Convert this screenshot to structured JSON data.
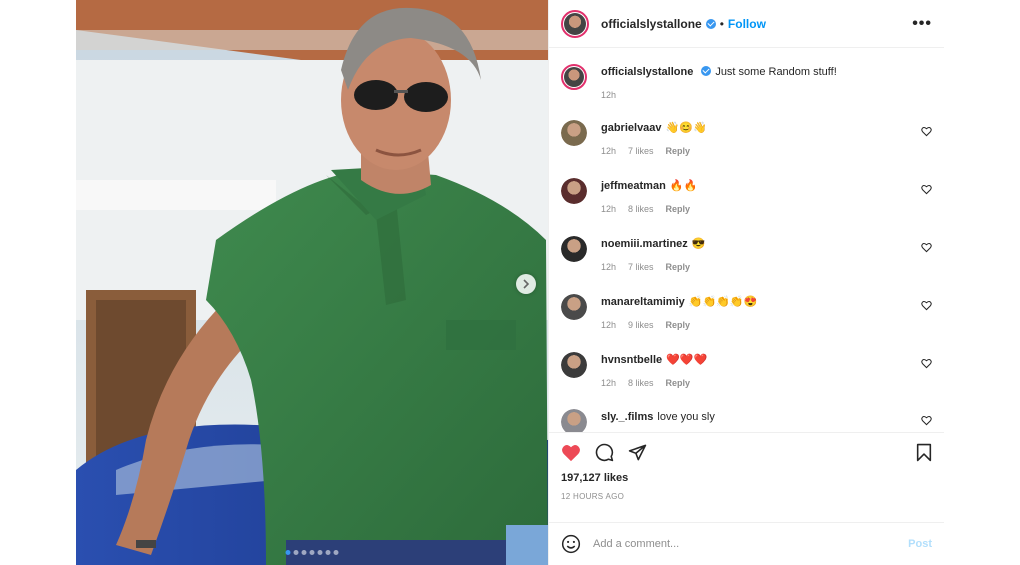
{
  "post": {
    "username": "officialslystallone",
    "follow_label": "Follow",
    "more_label": "•••",
    "caption": {
      "username": "officialslystallone",
      "text": "Just some Random stuff!",
      "time": "12h"
    }
  },
  "comments": [
    {
      "username": "gabrielvaav",
      "text": "👋😊👋",
      "time": "12h",
      "likes": "7 likes",
      "reply": "Reply",
      "avatar_color": "#7a6a4e"
    },
    {
      "username": "jeffmeatman",
      "text": "🔥🔥",
      "time": "12h",
      "likes": "8 likes",
      "reply": "Reply",
      "avatar_color": "#5a2d2d"
    },
    {
      "username": "noemiii.martinez",
      "text": "😎",
      "time": "12h",
      "likes": "7 likes",
      "reply": "Reply",
      "avatar_color": "#2a2a2a"
    },
    {
      "username": "manareltamimiy",
      "text": "👏👏👏👏😍",
      "time": "12h",
      "likes": "9 likes",
      "reply": "Reply",
      "avatar_color": "#4a4a4a"
    },
    {
      "username": "hvnsntbelle",
      "text": "❤️❤️❤️",
      "time": "12h",
      "likes": "8 likes",
      "reply": "Reply",
      "avatar_color": "#3b3b3b"
    },
    {
      "username": "sly._.films",
      "text": "love you sly",
      "time": "",
      "likes": "",
      "reply": "",
      "avatar_color": "#8a8a90"
    }
  ],
  "engagement": {
    "likes": "197,127 likes",
    "timestamp": "12 HOURS AGO",
    "liked": true
  },
  "composer": {
    "placeholder": "Add a comment...",
    "post_label": "Post"
  },
  "carousel": {
    "slide_count": 7,
    "active_index": 0
  },
  "icons": {
    "like": "heart-icon",
    "comment": "comment-icon",
    "share": "share-icon",
    "save": "bookmark-icon",
    "emoji": "emoji-icon",
    "next": "chevron-right-icon"
  },
  "colors": {
    "accent": "#0095f6",
    "liked_heart": "#ed4956",
    "post_button_disabled": "#b2dffc"
  }
}
